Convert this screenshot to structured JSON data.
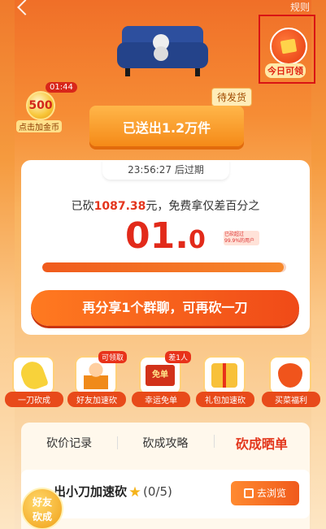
{
  "topbar": {
    "rules": "规则"
  },
  "today": {
    "label": "今日可领"
  },
  "coin": {
    "timer": "01:44",
    "value": "500",
    "label": "点击加金币"
  },
  "pedestal": {
    "tag": "待发货",
    "text": "已送出1.2万件"
  },
  "card": {
    "expire": "23:56:27 后过期",
    "bargain_prefix": "已砍",
    "bargain_amount": "1087.38",
    "bargain_suffix": "元，免费拿仅差百分之",
    "percent_main": "01.",
    "percent_small": "0",
    "mini_tag": "已砍超过99.9%的用户",
    "progress": 0.99,
    "share_button": "再分享1个群聊，可再砍一刀"
  },
  "features": [
    {
      "label": "一刀砍成",
      "badge": ""
    },
    {
      "label": "好友加速砍",
      "badge": "可领取"
    },
    {
      "label": "幸运免单",
      "badge": "差1人",
      "icon_text": "免单"
    },
    {
      "label": "礼包加速砍",
      "badge": ""
    },
    {
      "label": "买菜福利",
      "badge": ""
    }
  ],
  "tabs": [
    "砍价记录",
    "砍成攻略",
    "砍成晒单"
  ],
  "task": {
    "title": "出小刀加速砍",
    "count": "(0/5)",
    "button": "去浏览"
  },
  "float": {
    "line1": "好友",
    "line2": "砍成"
  },
  "colors": {
    "accent": "#e4351d",
    "orange": "#f7892c"
  }
}
